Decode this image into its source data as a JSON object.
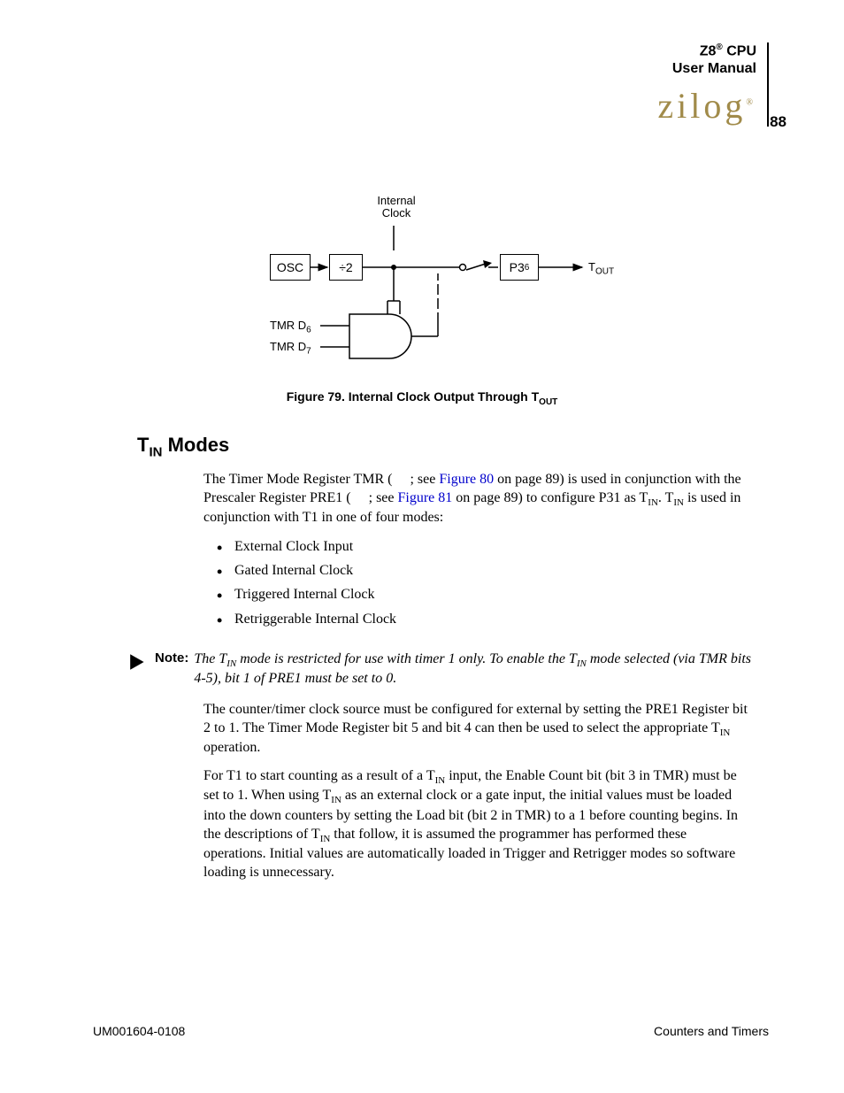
{
  "header": {
    "product": "Z8",
    "reg": "®",
    "cpu": " CPU",
    "subtitle": "User Manual",
    "page_number": "88",
    "logo_text": "zilog",
    "logo_reg": "®"
  },
  "diagram": {
    "internal_clock": "Internal\nClock",
    "osc": "OSC",
    "div2": "÷2",
    "p36": "P3",
    "p36_sub": "6",
    "tout": "T",
    "tout_sub": "OUT",
    "tmr_d6": "TMR D",
    "d6_sub": "6",
    "tmr_d7": "TMR D",
    "d7_sub": "7"
  },
  "figure_caption": {
    "prefix": "Figure 79. Internal Clock Output Through T",
    "sub": "OUT"
  },
  "section": {
    "t": "T",
    "in": "IN",
    "modes": " Modes"
  },
  "para1": {
    "a": "The Timer Mode Register TMR (     ; see ",
    "link1": "Figure 80",
    "b": " on page 89) is used in conjunction with the Prescaler Register PRE1 (     ; see ",
    "link2": "Figure 81",
    "c": " on page 89) to configure P31 as T",
    "c_sub": "IN",
    "d": ". T",
    "d_sub": "IN",
    "e": " is used in conjunction with T1 in one of four modes:"
  },
  "modes": [
    "External Clock Input",
    "Gated Internal Clock",
    "Triggered Internal Clock",
    "Retriggerable Internal Clock"
  ],
  "note": {
    "label": "Note:",
    "a": "The T",
    "a_sub": "IN",
    "b": " mode is restricted for use with timer 1 only. To enable the T",
    "b_sub": "IN",
    "c": " mode selected (via TMR bits 4-5), bit 1 of PRE1 must be set to 0."
  },
  "para2": {
    "a": "The counter/timer clock source must be configured for external by setting the PRE1 Register bit 2 to 1. The Timer Mode Register bit 5 and bit 4 can then be used to select the appropriate T",
    "a_sub": "IN",
    "b": " operation."
  },
  "para3": {
    "a": "For T1 to start counting as a result of a T",
    "a_sub": "IN",
    "b": " input, the Enable Count bit (bit 3 in TMR) must be set to 1. When using T",
    "b_sub": "IN",
    "c": " as an external clock or a gate input, the initial values must be loaded into the down counters by setting the Load bit (bit 2 in TMR) to a 1 before counting begins. In the descriptions of T",
    "c_sub": "IN",
    "d": " that follow, it is assumed the programmer has performed these operations. Initial values are automatically loaded in Trigger and Retrigger modes so software loading is unnecessary."
  },
  "footer": {
    "left": "UM001604-0108",
    "right": "Counters and Timers"
  }
}
